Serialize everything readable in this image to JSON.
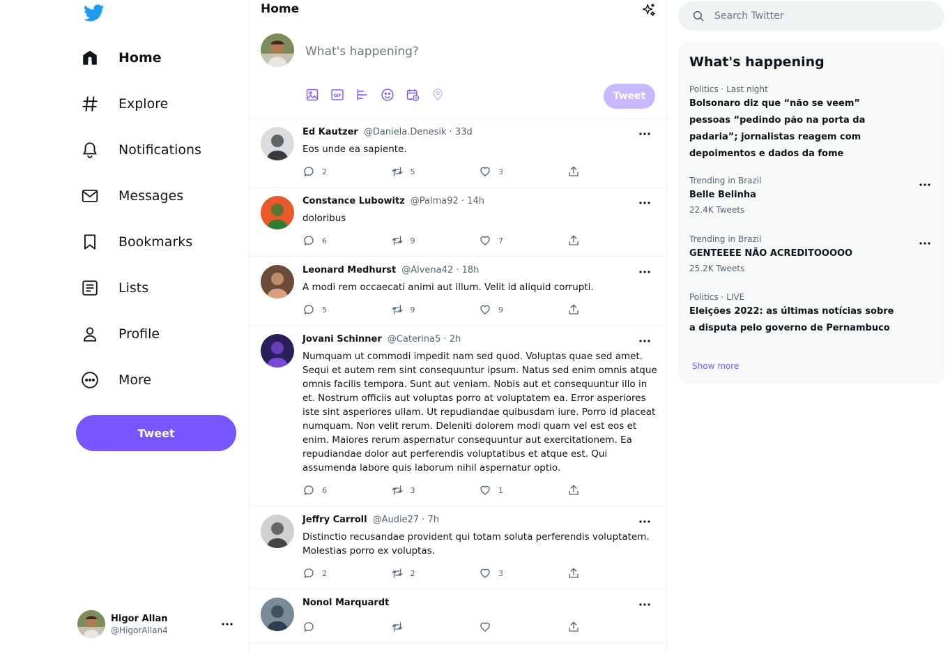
{
  "colors": {
    "accent": "#7856ff",
    "accent_disabled": "#c8b9ff",
    "logo": "#1d9bf0",
    "secondary_text": "#536471"
  },
  "sidebar": {
    "logo_icon": "twitter-bird-icon",
    "items": [
      {
        "label": "Home",
        "icon": "home-icon",
        "active": true
      },
      {
        "label": "Explore",
        "icon": "hashtag-icon"
      },
      {
        "label": "Notifications",
        "icon": "bell-icon"
      },
      {
        "label": "Messages",
        "icon": "envelope-icon"
      },
      {
        "label": "Bookmarks",
        "icon": "bookmark-icon"
      },
      {
        "label": "Lists",
        "icon": "list-icon"
      },
      {
        "label": "Profile",
        "icon": "user-icon"
      },
      {
        "label": "More",
        "icon": "more-circle-icon"
      }
    ],
    "tweet_button": "Tweet",
    "account": {
      "name": "Higor Allan",
      "handle": "@HigorAllan4"
    }
  },
  "main": {
    "title": "Home",
    "composer": {
      "placeholder": "What's happening?",
      "tweet_button": "Tweet",
      "tools": [
        "image-icon",
        "gif-icon",
        "poll-icon",
        "emoji-icon",
        "schedule-icon",
        "location-icon"
      ]
    },
    "tweets": [
      {
        "name": "Ed Kautzer",
        "meta": "@Daniela.Denesik · 33d",
        "text": "Eos unde ea sapiente.",
        "replies": "2",
        "retweets": "5",
        "likes": "3"
      },
      {
        "name": "Constance Lubowitz",
        "meta": "@Palma92 · 14h",
        "text": "doloribus",
        "replies": "6",
        "retweets": "9",
        "likes": "7"
      },
      {
        "name": "Leonard Medhurst",
        "meta": "@Alvena42 · 18h",
        "text": "A modi rem occaecati animi aut illum. Velit id aliquid corrupti.",
        "replies": "5",
        "retweets": "9",
        "likes": "9"
      },
      {
        "name": "Jovani Schinner",
        "meta": "@Caterina5 · 2h",
        "text": "Numquam ut commodi impedit nam sed quod. Voluptas quae sed amet. Sequi et autem rem sint consequuntur ipsum. Natus sed enim omnis atque omnis facilis tempora. Sunt aut veniam. Nobis aut et consequuntur illo in et. Nostrum officiis aut voluptas porro at voluptatem ea. Error asperiores iste sint asperiores ullam. Ut repudiandae quibusdam iure. Porro id placeat numquam. Non velit rerum. Deleniti dolorem modi quam vel est eos et enim. Maiores rerum aspernatur consequuntur aut exercitationem. Ea repudiandae dolor aut perferendis voluptatibus et atque est. Qui assumenda labore quis laborum nihil aspernatur optio.",
        "replies": "6",
        "retweets": "3",
        "likes": "1"
      },
      {
        "name": "Jeffry Carroll",
        "meta": "@Audie27 · 7h",
        "text": "Distinctio recusandae provident qui totam soluta perferendis voluptatem. Molestias porro ex voluptas.",
        "replies": "2",
        "retweets": "2",
        "likes": "3"
      },
      {
        "name": "Nonol Marquardt",
        "meta": "",
        "text": "",
        "replies": "",
        "retweets": "",
        "likes": ""
      }
    ]
  },
  "right": {
    "search_placeholder": "Search Twitter",
    "trends_title": "What's happening",
    "trends": [
      {
        "context": "Politics · Last night",
        "title": "Bolsonaro diz que “não se veem” pessoas “pedindo pão na porta da padaria”; jornalistas reagem com depoimentos e dados da fome",
        "count": ""
      },
      {
        "context": "Trending in Brazil",
        "title": "Belle Belinha",
        "count": "22.4K Tweets"
      },
      {
        "context": "Trending in Brazil",
        "title": "GENTEEEE NÃO ACREDITOOOOO",
        "count": "25.2K Tweets"
      },
      {
        "context": "Politics · LIVE",
        "title": "Eleições 2022: as últimas notícias sobre a disputa pelo governo de Pernambuco",
        "count": ""
      }
    ],
    "show_more": "Show more"
  }
}
